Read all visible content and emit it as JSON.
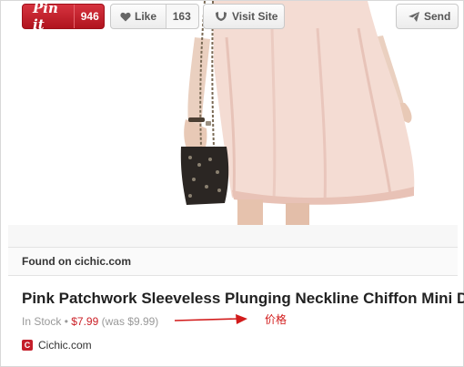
{
  "toolbar": {
    "pin_label": "Pin it",
    "pin_count": "946",
    "like_label": "Like",
    "like_count": "163",
    "visit_label": "Visit Site",
    "send_label": "Send"
  },
  "found_on": "Found on cichic.com",
  "product": {
    "title": "Pink Patchwork Sleeveless Plunging Neckline Chiffon Mini D",
    "stock_status": "In Stock",
    "separator": " • ",
    "price": "$7.99",
    "was_price": "(was $9.99)"
  },
  "annotation": {
    "label": "价格"
  },
  "source": {
    "icon_letter": "C",
    "name": "Cichic.com"
  },
  "colors": {
    "pin_red": "#cb2027",
    "annotation_red": "#d21b1b",
    "dress_pink": "#f2d4cc"
  }
}
